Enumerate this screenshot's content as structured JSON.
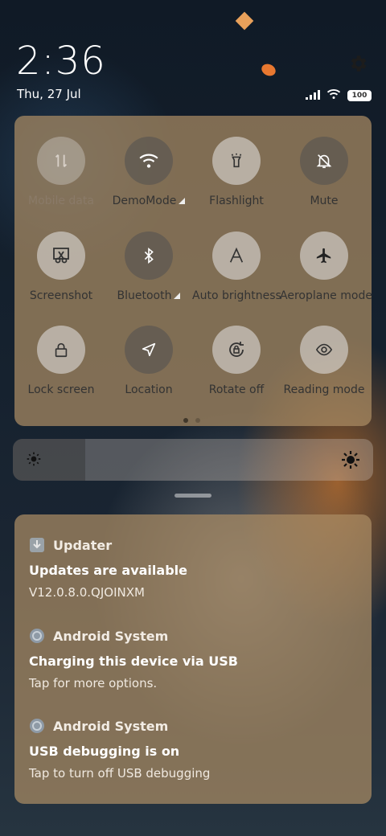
{
  "status": {
    "time": "2:36",
    "date": "Thu, 27 Jul",
    "battery": "100",
    "icons": [
      "signal-icon",
      "wifi-icon",
      "battery-icon"
    ]
  },
  "settings": {
    "icon": "gear-icon"
  },
  "tiles": [
    {
      "label": "Mobile data",
      "icon": "mobile-data-icon",
      "state": "disabled"
    },
    {
      "label": "DemoMode",
      "icon": "wifi-icon",
      "state": "on",
      "expandable": true
    },
    {
      "label": "Flashlight",
      "icon": "flashlight-icon",
      "state": "off"
    },
    {
      "label": "Mute",
      "icon": "bell-off-icon",
      "state": "on"
    },
    {
      "label": "Screenshot",
      "icon": "screenshot-icon",
      "state": "off"
    },
    {
      "label": "Bluetooth",
      "icon": "bluetooth-icon",
      "state": "on",
      "expandable": true
    },
    {
      "label": "Auto brightness",
      "icon": "auto-brightness-icon",
      "state": "off"
    },
    {
      "label": "Aeroplane mode",
      "icon": "airplane-icon",
      "state": "off"
    },
    {
      "label": "Lock screen",
      "icon": "lock-icon",
      "state": "off"
    },
    {
      "label": "Location",
      "icon": "location-icon",
      "state": "on"
    },
    {
      "label": "Rotate off",
      "icon": "rotate-lock-icon",
      "state": "off"
    },
    {
      "label": "Reading mode",
      "icon": "eye-icon",
      "state": "off"
    }
  ],
  "pager": {
    "pages": 2,
    "current": 1
  },
  "brightness": {
    "level": 0.2,
    "icon_low": "sun-small-icon",
    "icon_high": "sun-large-icon"
  },
  "notifications": [
    {
      "app": "Updater",
      "title": "Updates are available",
      "body": "V12.0.8.0.QJOINXM",
      "icon": "updater-icon"
    },
    {
      "app": "Android System",
      "title": "Charging this device via USB",
      "body": "Tap for more options.",
      "icon": "android-system-icon"
    },
    {
      "app": "Android System",
      "title": "USB debugging is on",
      "body": "Tap to turn off USB debugging",
      "icon": "android-system-icon"
    }
  ]
}
